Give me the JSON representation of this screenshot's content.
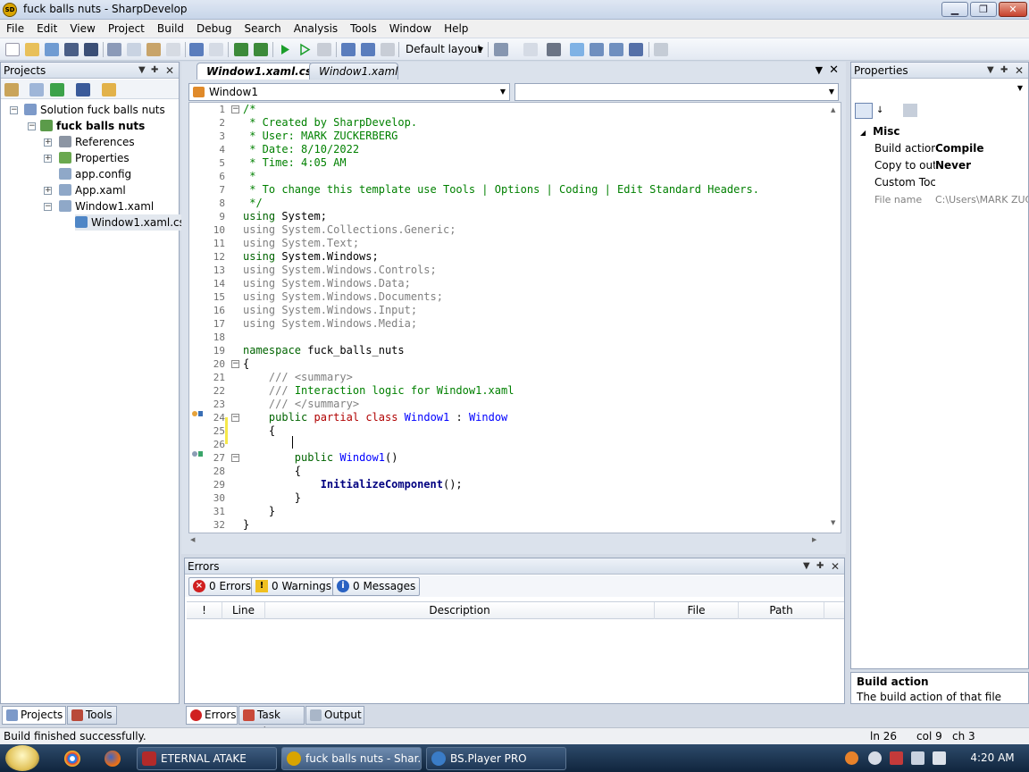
{
  "window": {
    "title": "fuck balls nuts - SharpDevelop",
    "app_icon_text": "SD",
    "min_glyph": "▁",
    "max_glyph": "❐",
    "close_glyph": "✕"
  },
  "menu": [
    "File",
    "Edit",
    "View",
    "Project",
    "Build",
    "Debug",
    "Search",
    "Analysis",
    "Tools",
    "Window",
    "Help"
  ],
  "toolbar": {
    "layout_dropdown": "Default layout"
  },
  "projects_panel": {
    "title": "Projects",
    "tree": [
      {
        "label": "Solution fuck balls nuts",
        "bold": false,
        "expander": "−"
      },
      {
        "label": "fuck balls nuts",
        "bold": true,
        "expander": "−"
      },
      {
        "label": "References",
        "bold": false,
        "expander": "+"
      },
      {
        "label": "Properties",
        "bold": false,
        "expander": "+"
      },
      {
        "label": "app.config",
        "bold": false,
        "expander": ""
      },
      {
        "label": "App.xaml",
        "bold": false,
        "expander": "+"
      },
      {
        "label": "Window1.xaml",
        "bold": false,
        "expander": "−"
      },
      {
        "label": "Window1.xaml.cs",
        "bold": false,
        "expander": ""
      }
    ],
    "bottom_tabs": [
      "Projects",
      "Tools"
    ]
  },
  "editor": {
    "tabs": [
      "Window1.xaml.cs*",
      "Window1.xaml"
    ],
    "class_dropdown": "Window1",
    "member_dropdown": "",
    "lines": [
      "/*",
      " * Created by SharpDevelop.",
      " * User: MARK ZUCKERBERG",
      " * Date: 8/10/2022",
      " * Time: 4:05 AM",
      " *",
      " * To change this template use Tools | Options | Coding | Edit Standard Headers.",
      " */",
      "using System;",
      "using System.Collections.Generic;",
      "using System.Text;",
      "using System.Windows;",
      "using System.Windows.Controls;",
      "using System.Windows.Data;",
      "using System.Windows.Documents;",
      "using System.Windows.Input;",
      "using System.Windows.Media;",
      "",
      "namespace fuck_balls_nuts",
      "{",
      "    /// <summary>",
      "    /// Interaction logic for Window1.xaml",
      "    /// </summary>",
      "    public partial class Window1 : Window",
      "    {",
      "        ",
      "        public Window1()",
      "        {",
      "            InitializeComponent();",
      "        }",
      "    }",
      "}"
    ]
  },
  "errors_panel": {
    "title": "Errors",
    "filters": [
      "0 Errors",
      "0 Warnings",
      "0 Messages"
    ],
    "columns": [
      "!",
      "Line",
      "Description",
      "File",
      "Path"
    ],
    "bottom_tabs": [
      "Errors",
      "Task List",
      "Output"
    ]
  },
  "properties_panel": {
    "title": "Properties",
    "category": "Misc",
    "rows": [
      {
        "name": "Build action",
        "value": "Compile",
        "bold": true
      },
      {
        "name": "Copy to out",
        "value": "Never",
        "bold": true
      },
      {
        "name": "Custom Toc",
        "value": "",
        "bold": false
      },
      {
        "name": "File name",
        "value": "C:\\Users\\MARK ZUC",
        "bold": false,
        "gray": true
      }
    ],
    "description_title": "Build action",
    "description_text": "The build action of that file"
  },
  "statusbar": {
    "message": "Build finished successfully.",
    "ln": "ln 26",
    "col": "col 9",
    "ch": "ch 3"
  },
  "taskbar": {
    "items": [
      "ETERNAL ATAKE",
      "fuck balls nuts - Shar...",
      "BS.Player PRO"
    ],
    "clock": "4:20 AM"
  },
  "colors": {
    "comment": "#008000",
    "keyword": "#006400",
    "unused_using": "#808080",
    "type": "#0000ff",
    "accent": "#2d4a6a"
  }
}
